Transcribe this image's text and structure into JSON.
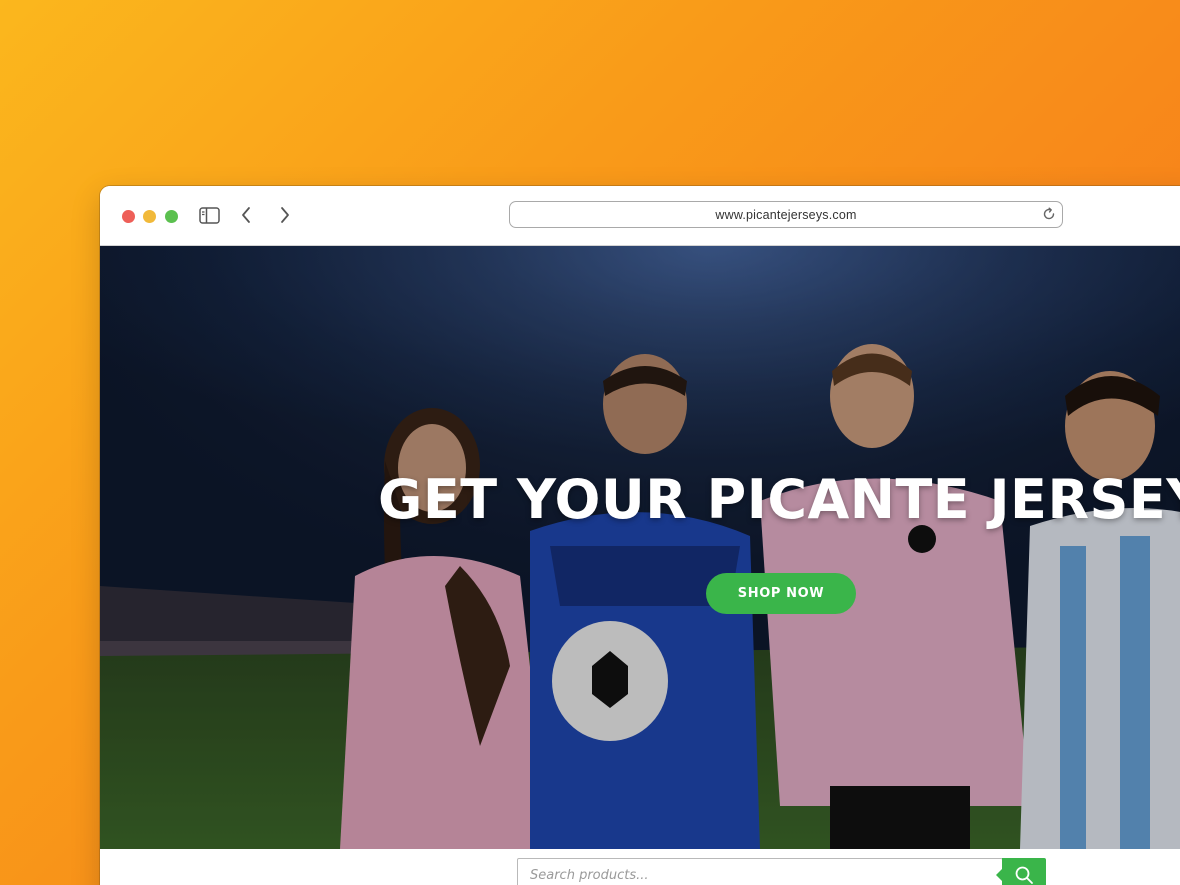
{
  "browser": {
    "url": "www.picantejerseys.com",
    "traffic_lights": {
      "close": "#ee5f58",
      "minimize": "#f1b93a",
      "maximize": "#5bc04f"
    },
    "icons": {
      "sidebar": "sidebar-icon",
      "back": "chevron-left-icon",
      "forward": "chevron-right-icon",
      "reload": "reload-icon"
    }
  },
  "hero": {
    "title": "GET YOUR PICANTE JERSEY",
    "cta_label": "SHOP NOW"
  },
  "search": {
    "placeholder": "Search products...",
    "button_icon": "search-icon"
  },
  "colors": {
    "accent": "#3ab54a",
    "background_gradient": [
      "#fbb71d",
      "#f47a18"
    ]
  }
}
